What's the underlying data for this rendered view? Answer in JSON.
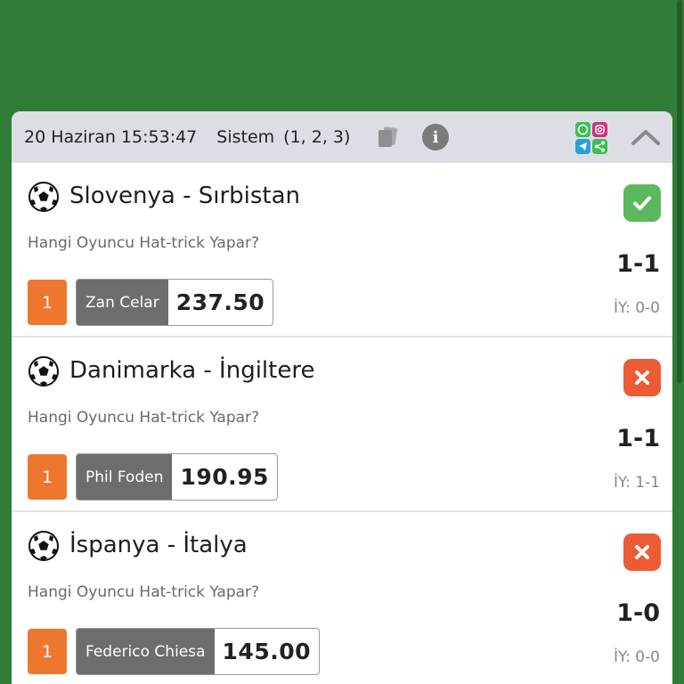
{
  "header": {
    "date": "20 Haziran 15:53:47",
    "type": "Sistem",
    "combination": "(1, 2, 3)",
    "icons": [
      "copy-icon",
      "info-icon",
      "social-share-icon",
      "chevron-up-icon"
    ]
  },
  "matches": [
    {
      "title": "Slovenya - Sırbistan",
      "market": "Hangi Oyuncu Hat-trick Yapar?",
      "pick_number": "1",
      "player": "Zan Celar",
      "odds": "237.50",
      "status": "won",
      "status_icon": "check-icon",
      "score": "1-1",
      "half_time": "İY: 0-0"
    },
    {
      "title": "Danimarka - İngiltere",
      "market": "Hangi Oyuncu Hat-trick Yapar?",
      "pick_number": "1",
      "player": "Phil Foden",
      "odds": "190.95",
      "status": "lost",
      "status_icon": "close-icon",
      "score": "1-1",
      "half_time": "İY: 1-1"
    },
    {
      "title": "İspanya - İtalya",
      "market": "Hangi Oyuncu Hat-trick Yapar?",
      "pick_number": "1",
      "player": "Federico Chiesa",
      "odds": "145.00",
      "status": "lost",
      "status_icon": "close-icon",
      "score": "1-0",
      "half_time": "İY: 0-0"
    }
  ],
  "colors": {
    "background": "#2f7d37",
    "header_bg": "#dcdde5",
    "won": "#5cb85c",
    "lost": "#ec5b34",
    "pick_number": "#ee7730",
    "player_bg": "#6d6d6d"
  }
}
